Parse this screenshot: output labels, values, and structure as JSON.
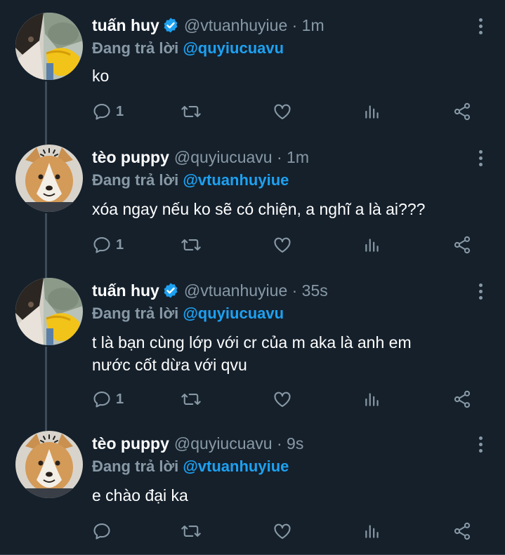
{
  "reply_prefix": "Đang trả lời",
  "tweets": [
    {
      "name": "tuấn huy",
      "verified": true,
      "handle": "@vtuanhuyiue · 1m",
      "reply_to": "@quyiucuavu",
      "body_lines": [
        "ko"
      ],
      "reply_count": "1",
      "avatar": "anime-duck-avatar"
    },
    {
      "name": "tèo puppy",
      "verified": false,
      "handle": "@quyiucuavu · 1m",
      "reply_to": "@vtuanhuyiue",
      "body_lines": [
        "xóa ngay nếu ko sẽ có chiện, a nghĩ a là ai???"
      ],
      "reply_count": "1",
      "avatar": "corgi-avatar"
    },
    {
      "name": "tuấn huy",
      "verified": true,
      "handle": "@vtuanhuyiue · 35s",
      "reply_to": "@quyiucuavu",
      "body_lines": [
        "t là bạn cùng lớp với cr của m aka là anh em",
        "nước cốt dừa với qvu"
      ],
      "reply_count": "1",
      "avatar": "anime-duck-avatar"
    },
    {
      "name": "tèo puppy",
      "verified": false,
      "handle": "@quyiucuavu · 9s",
      "reply_to": "@vtuanhuyiue",
      "body_lines": [
        "e chào đại ka"
      ],
      "reply_count": "",
      "avatar": "corgi-avatar"
    }
  ],
  "colors": {
    "background": "#15202b",
    "muted": "#8899a6",
    "accent": "#1da1f2",
    "thread_line": "#3d4b58"
  }
}
